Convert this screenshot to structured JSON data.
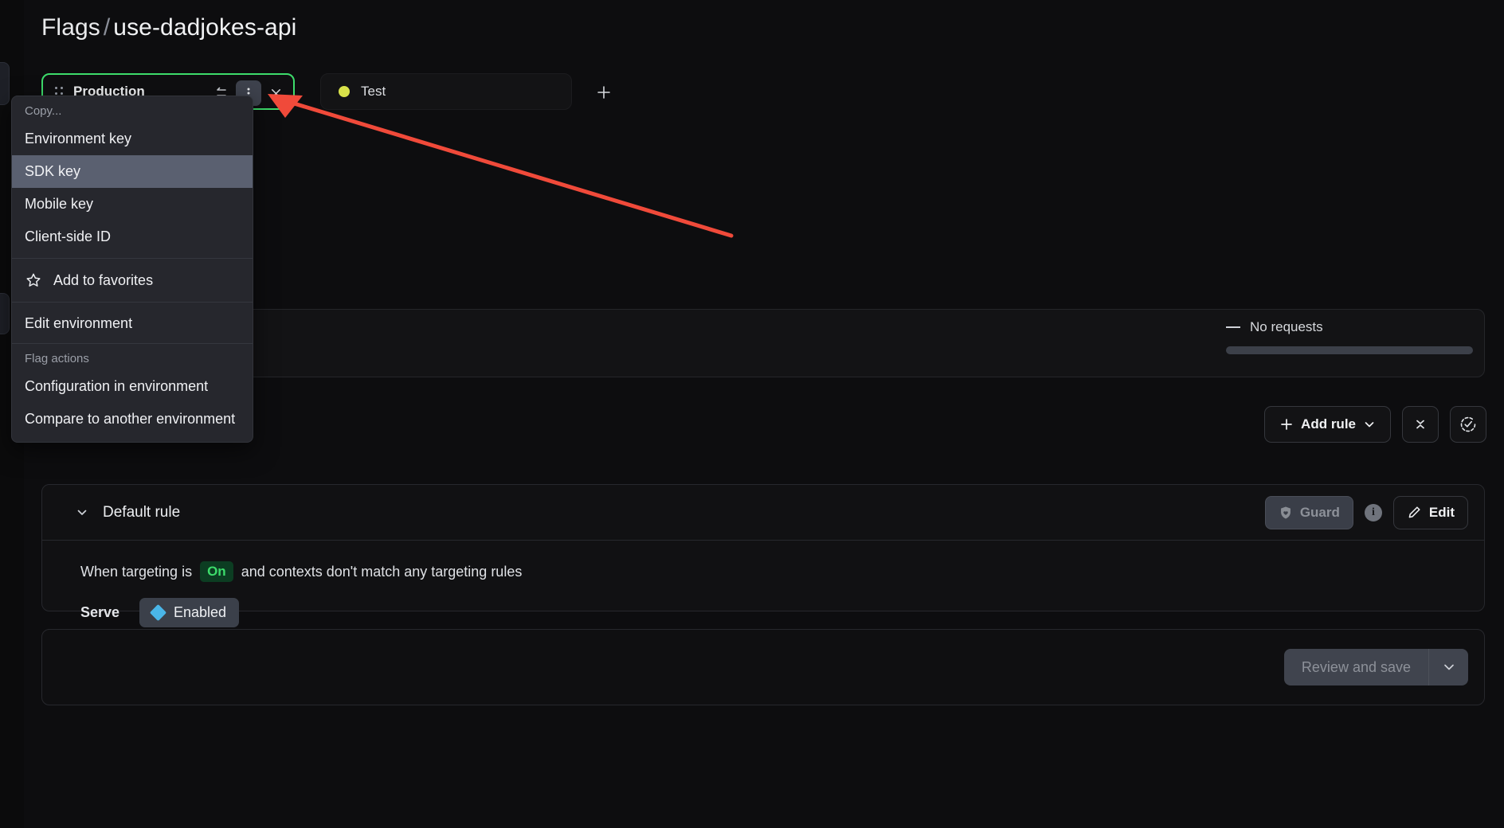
{
  "page": {
    "breadcrumb_root": "Flags",
    "breadcrumb_sep": "/",
    "breadcrumb_leaf": "use-dadjokes-api"
  },
  "environments": {
    "tabs": [
      {
        "name": "Production",
        "selected": true,
        "dot_color": "#3ddc6b"
      },
      {
        "name": "Test",
        "selected": false,
        "dot_color": "#d9e24a"
      }
    ],
    "add_tab_label": "+",
    "icons": {
      "drag": "drag-handle-icon",
      "swap": "swap-arrows-icon",
      "overflow": "kebab-menu-icon",
      "close": "close-icon",
      "add": "plus-icon"
    }
  },
  "env_menu": {
    "copy_label": "Copy...",
    "copy_items": [
      {
        "label": "Environment key",
        "highlighted": false
      },
      {
        "label": "SDK key",
        "highlighted": true
      },
      {
        "label": "Mobile key",
        "highlighted": false
      },
      {
        "label": "Client-side ID",
        "highlighted": false
      }
    ],
    "favorites_item": {
      "label": "Add to favorites",
      "icon": "star-icon"
    },
    "edit_item": {
      "label": "Edit environment"
    },
    "flag_actions_label": "Flag actions",
    "flag_action_items": [
      {
        "label": "Configuration in environment"
      },
      {
        "label": "Compare to another environment"
      }
    ]
  },
  "requests_card": {
    "dash": "—",
    "status_text": "No requests"
  },
  "rules_toolbar": {
    "add_rule_label": "Add rule",
    "add_rule_plus": "+",
    "collapse_all_icon": "collapse-all-icon",
    "review_status_icon": "check-circle-dashed-icon"
  },
  "default_rule": {
    "title": "Default rule",
    "guard_label": "Guard",
    "guard_icon": "shield-heart-icon",
    "info_icon": "info-icon",
    "edit_label": "Edit",
    "edit_icon": "pencil-icon",
    "condition_prefix": "When targeting is",
    "targeting_state": "On",
    "condition_suffix": "and contexts don't match any targeting rules",
    "serve_label": "Serve",
    "serve_variation": "Enabled",
    "variation_swatch_color": "#4ab6e8"
  },
  "footer": {
    "save_label": "Review and save",
    "save_caret_icon": "chevron-down-icon"
  },
  "annotation": {
    "arrow_color": "#f04a3a",
    "target": "kebab-menu-icon"
  }
}
